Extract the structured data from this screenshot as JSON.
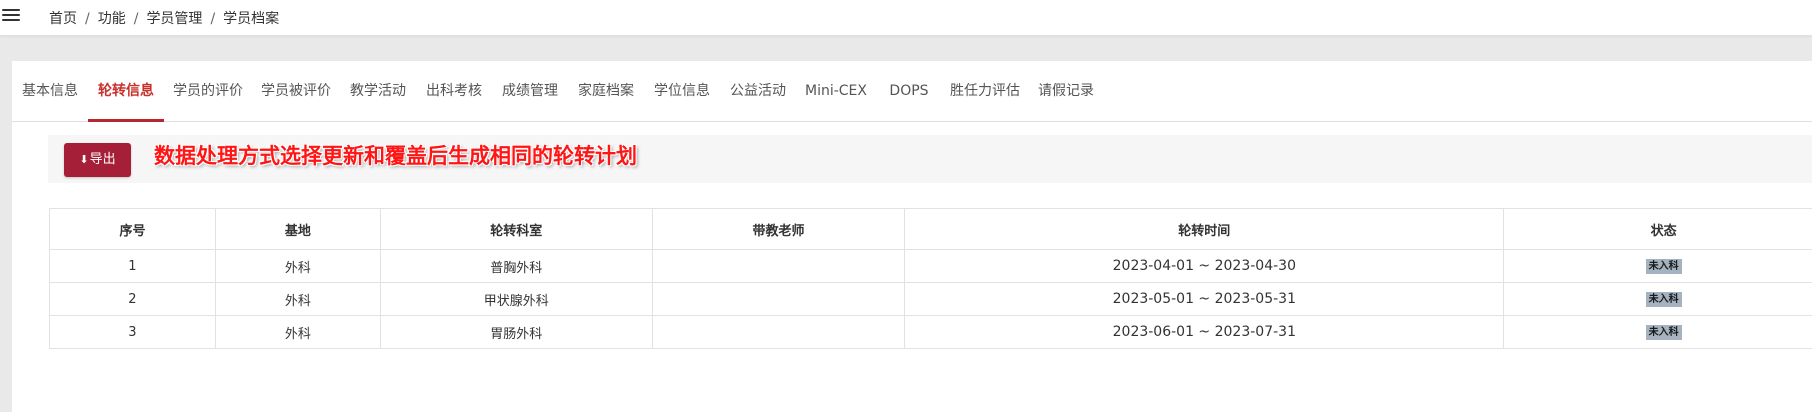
{
  "breadcrumb": {
    "items": [
      "首页",
      "功能",
      "学员管理",
      "学员档案"
    ],
    "separator": "/"
  },
  "tabs": [
    {
      "label": "基本信息",
      "active": false
    },
    {
      "label": "轮转信息",
      "active": true
    },
    {
      "label": "学员的评价",
      "active": false
    },
    {
      "label": "学员被评价",
      "active": false
    },
    {
      "label": "教学活动",
      "active": false
    },
    {
      "label": "出科考核",
      "active": false
    },
    {
      "label": "成绩管理",
      "active": false
    },
    {
      "label": "家庭档案",
      "active": false
    },
    {
      "label": "学位信息",
      "active": false
    },
    {
      "label": "公益活动",
      "active": false
    },
    {
      "label": "Mini-CEX",
      "active": false
    },
    {
      "label": "DOPS",
      "active": false
    },
    {
      "label": "胜任力评估",
      "active": false
    },
    {
      "label": "请假记录",
      "active": false
    }
  ],
  "toolbar": {
    "export_label": "导出",
    "export_icon": "download-icon",
    "annotation": "数据处理方式选择更新和覆盖后生成相同的轮转计划"
  },
  "table": {
    "headers": [
      "序号",
      "基地",
      "轮转科室",
      "带教老师",
      "轮转时间",
      "状态"
    ],
    "rows": [
      {
        "index": "1",
        "base": "外科",
        "dept": "普胸外科",
        "teacher": "",
        "time": "2023-04-01 ~ 2023-04-30",
        "status": "未入科"
      },
      {
        "index": "2",
        "base": "外科",
        "dept": "甲状腺外科",
        "teacher": "",
        "time": "2023-05-01 ~ 2023-05-31",
        "status": "未入科"
      },
      {
        "index": "3",
        "base": "外科",
        "dept": "胃肠外科",
        "teacher": "",
        "time": "2023-06-01 ~ 2023-07-31",
        "status": "未入科"
      }
    ]
  },
  "colors": {
    "accent": "#b8262e",
    "export_button": "#a51f38",
    "annotation": "#ff1515",
    "status_badge": "#a5b3c1"
  }
}
